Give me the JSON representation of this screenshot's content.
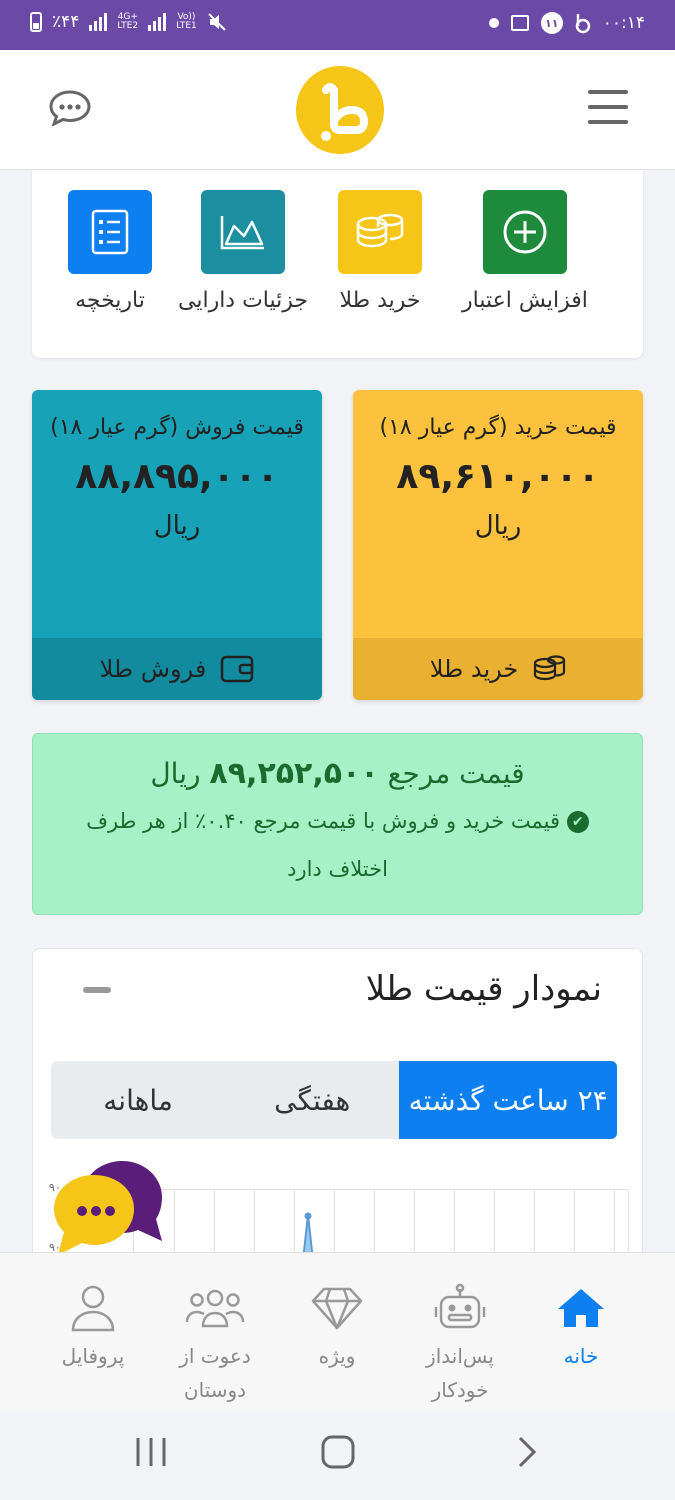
{
  "status_bar": {
    "battery": "٪۴۴",
    "net1": "4G+",
    "net1_sub": "LTE2",
    "net2": "Vo))",
    "net2_sub": "LTE1",
    "badge": "۱۱",
    "time": "۰۰:۱۴"
  },
  "quick_actions": [
    {
      "label": "افزایش اعتبار",
      "icon": "plus-circle-icon",
      "color": "#1e8a3c"
    },
    {
      "label": "خرید طلا",
      "icon": "coins-icon",
      "color": "#f5c518"
    },
    {
      "label": "جزئیات دارایی",
      "icon": "area-chart-icon",
      "color": "#1b8fa0"
    },
    {
      "label": "تاریخچه",
      "icon": "checklist-icon",
      "color": "#0d7ff0"
    }
  ],
  "buy_card": {
    "title": "قیمت خرید (گرم عیار ۱۸)",
    "value": "۸۹,۶۱۰,۰۰۰",
    "unit": "ریال",
    "action": "خرید طلا"
  },
  "sell_card": {
    "title": "قیمت فروش (گرم عیار ۱۸)",
    "value": "۸۸,۸۹۵,۰۰۰",
    "unit": "ریال",
    "action": "فروش طلا"
  },
  "reference": {
    "label": "قیمت مرجع",
    "value": "۸۹,۲۵۲,۵۰۰",
    "unit": "ریال",
    "note": "قیمت خرید و فروش با قیمت مرجع ۰.۴۰٪ از هر طرف اختلاف دارد"
  },
  "chart": {
    "title": "نمودار قیمت طلا",
    "tabs": [
      "۲۴ ساعت گذشته",
      "هفتگی",
      "ماهانه"
    ],
    "active_tab": 0,
    "ytick_top": "۹۰",
    "ytick_bottom": "۹۰"
  },
  "bottom_nav": [
    {
      "label": "خانه",
      "icon": "home-icon",
      "active": true
    },
    {
      "label": "پس‌انداز خودکار",
      "icon": "robot-icon",
      "active": false
    },
    {
      "label": "ویژه",
      "icon": "diamond-icon",
      "active": false
    },
    {
      "label": "دعوت از دوستان",
      "icon": "users-icon",
      "active": false
    },
    {
      "label": "پروفایل",
      "icon": "user-icon",
      "active": false
    }
  ],
  "colors": {
    "status_bar": "#6a4aa6",
    "accent": "#0d7ff0",
    "buy": "#fcc23d",
    "sell": "#17a2b8",
    "reference_bg": "#a8f0c6"
  }
}
